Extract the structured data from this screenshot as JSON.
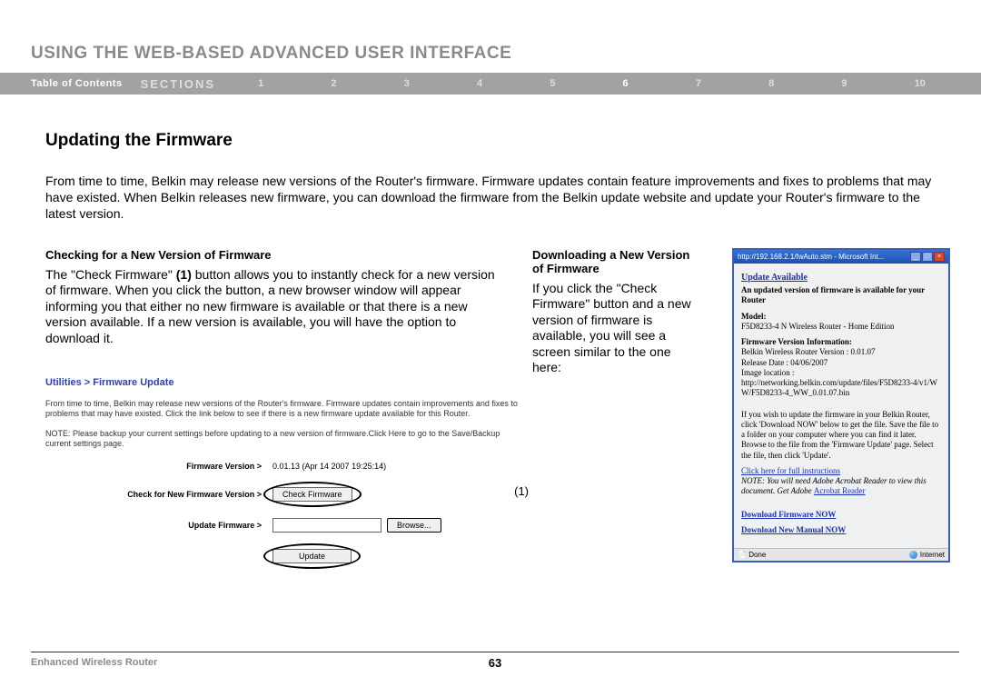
{
  "header": {
    "title": "USING THE WEB-BASED ADVANCED USER INTERFACE"
  },
  "nav": {
    "toc": "Table of Contents",
    "sections_label": "SECTIONS",
    "items": [
      "1",
      "2",
      "3",
      "4",
      "5",
      "6",
      "7",
      "8",
      "9",
      "10"
    ],
    "active": "6"
  },
  "page": {
    "heading": "Updating the Firmware",
    "intro": "From time to time, Belkin may release new versions of the Router's firmware. Firmware updates contain feature improvements and fixes to problems that may have existed. When Belkin releases new firmware, you can download the firmware from the Belkin update website and update your Router's firmware to the latest version."
  },
  "left": {
    "subhead": "Checking for a New Version of Firmware",
    "body_pre": "The \"Check Firmware\" ",
    "body_em": "(1)",
    "body_post": " button allows you to instantly check for a new version of firmware. When you click the button, a new browser window will appear informing you that either no new firmware is available or that there is a new version available. If a new version is available, you will have the option to download it."
  },
  "mid": {
    "subhead": "Downloading a New Version of Firmware",
    "body": "If you click the \"Check Firmware\" button and a new version of firmware is available, you will see a screen similar to the one here:"
  },
  "ss1": {
    "crumb": "Utilities > Firmware Update",
    "p1": "From time to time, Belkin may release new versions of the Router's firmware. Firmware updates contain improvements and fixes to problems that may have existed. Click the link below to see if there is a new firmware update available for this Router.",
    "p2": "NOTE: Please backup your current settings before updating to a new version of firmware.Click Here to go to the Save/Backup current settings page.",
    "r1_label": "Firmware Version >",
    "r1_val": "0.01.13 (Apr 14 2007 19:25:14)",
    "r2_label": "Check for New Firmware Version >",
    "r2_btn": "Check Firmware",
    "r3_label": "Update Firmware >",
    "r3_btn": "Browse...",
    "r4_btn": "Update",
    "callout": "(1)"
  },
  "ss2": {
    "titlebar_url": "http://192.168.2.1/fwAuto.stm - Microsoft Int...",
    "ua": "Update Available",
    "ua_sub": "An updated version of firmware is available for your Router",
    "model_label": "Model:",
    "model_val": "F5D8233-4 N Wireless Router - Home Edition",
    "fvi_label": "Firmware Version Information:",
    "fvi_l1": "Belkin Wireless Router Version : 0.01.07",
    "fvi_l2": "Release Date : 04/06/2007",
    "fvi_l3": "Image location :",
    "fvi_l4": "http://networking.belkin.com/update/files/F5D8233-4/v1/WW/F5D8233-4_WW_0.01.07.bin",
    "instr": "If you wish to update the firmware in your Belkin Router, click 'Download NOW' below to get the file. Save the file to a folder on your computer where you can find it later. Browse to the file from the 'Firmware Update' page. Select the file, then click 'Update'.",
    "click_here": "Click here for full instructions",
    "note": "NOTE: You will need Adobe Acrobat Reader to view this document. Get Adobe",
    "acrobat": "Acrobat Reader",
    "dl_fw": "Download Firmware NOW",
    "dl_man": "Download New Manual NOW",
    "status_done": "Done",
    "status_net": "Internet"
  },
  "footer": {
    "left": "Enhanced Wireless Router",
    "page": "63"
  }
}
